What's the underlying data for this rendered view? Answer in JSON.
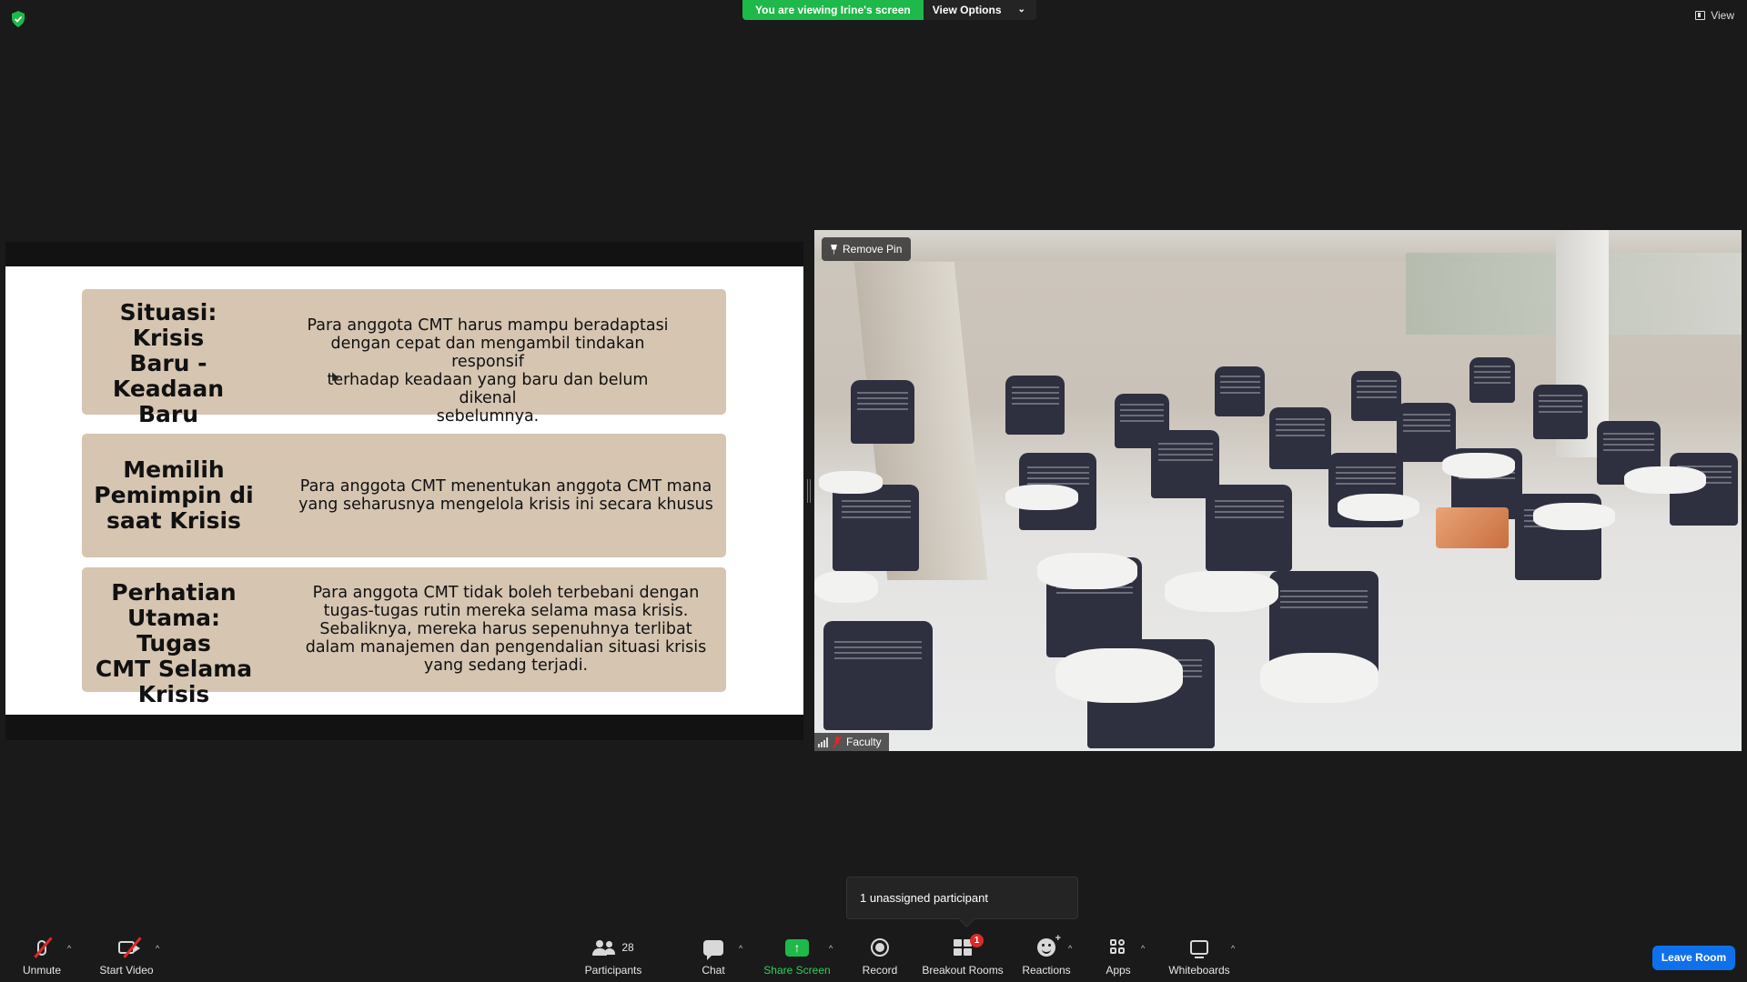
{
  "top_bar": {
    "viewing_label": "You are viewing Irine's screen",
    "view_options_label": "View Options",
    "view_label": "View"
  },
  "slide": {
    "boxes": [
      {
        "title_lines": [
          "Situasi: Krisis",
          "Baru -",
          "Keadaan",
          "Baru"
        ],
        "body_lines": [
          "Para anggota CMT  harus mampu beradaptasi",
          "dengan cepat dan mengambil tindakan responsif",
          "terhadap keadaan yang baru dan belum dikenal",
          "sebelumnya."
        ]
      },
      {
        "title_lines": [
          "Memilih",
          "Pemimpin di",
          "saat Krisis"
        ],
        "body_lines": [
          "Para anggota CMT menentukan anggota CMT mana",
          "yang seharusnya mengelola krisis ini secara khusus"
        ]
      },
      {
        "title_lines": [
          "Perhatian",
          "Utama: Tugas",
          "CMT Selama",
          "Krisis"
        ],
        "body_lines": [
          "Para anggota CMT tidak boleh terbebani dengan",
          "tugas-tugas rutin mereka selama masa krisis.",
          "Sebaliknya, mereka harus sepenuhnya terlibat",
          "dalam manajemen dan pengendalian situasi krisis",
          "yang sedang terjadi."
        ]
      }
    ]
  },
  "video": {
    "pin_label": "Remove Pin",
    "participant_name": "Faculty"
  },
  "tooltip": {
    "text": "1 unassigned participant"
  },
  "toolbar": {
    "unmute": "Unmute",
    "start_video": "Start Video",
    "participants": "Participants",
    "participants_count": "28",
    "chat": "Chat",
    "share_screen": "Share Screen",
    "share_arrow": "↑",
    "record": "Record",
    "breakout_rooms": "Breakout Rooms",
    "breakout_badge": "1",
    "reactions": "Reactions",
    "apps": "Apps",
    "whiteboards": "Whiteboards",
    "leave_room": "Leave Room"
  },
  "colors": {
    "accent_green": "#1fb84a",
    "leave_blue": "#0e71eb",
    "muted_red": "#e02828",
    "slide_box": "#d6c5b1"
  },
  "icons": [
    "shield-icon",
    "chevron-down-icon",
    "view-icon",
    "pin-icon",
    "signal-icon",
    "mic-muted-icon",
    "mic-icon",
    "video-off-icon",
    "participants-icon",
    "chat-icon",
    "share-screen-icon",
    "record-icon",
    "breakout-rooms-icon",
    "reactions-icon",
    "apps-icon",
    "whiteboard-icon"
  ]
}
